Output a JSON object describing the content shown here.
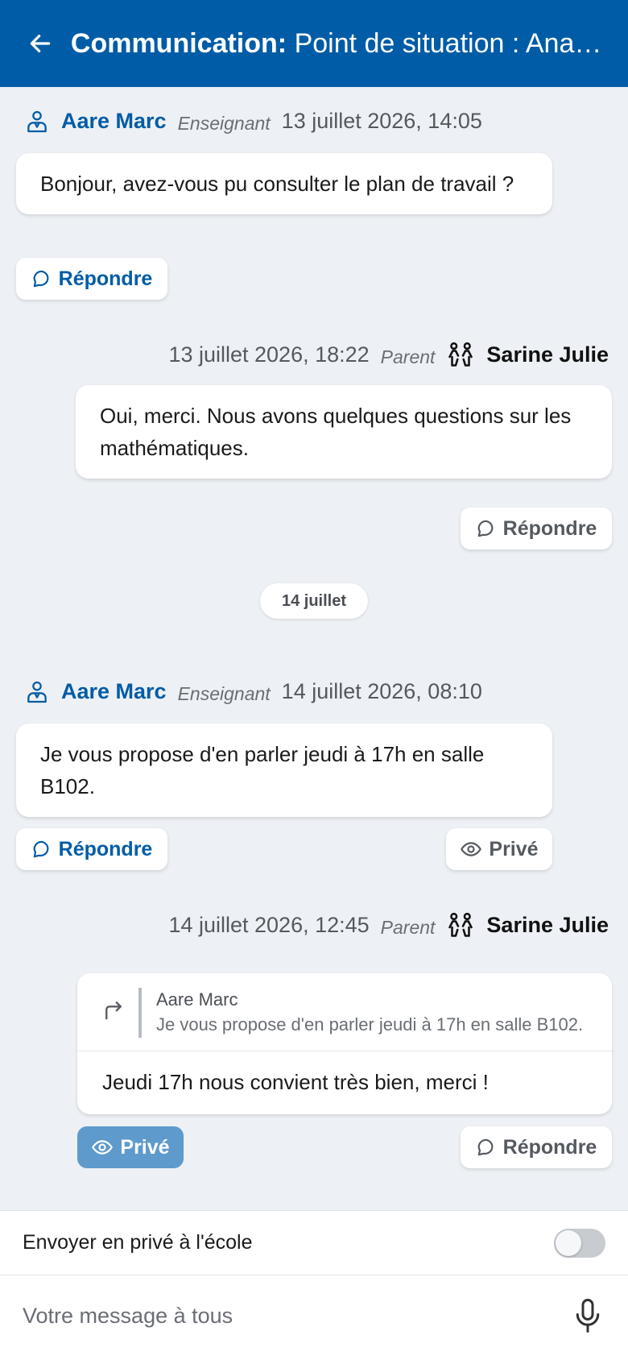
{
  "header": {
    "title_bold": "Communication:",
    "title_rest": "Point de situation : Anaïs ...",
    "back_icon": "arrow-left-icon"
  },
  "messages": [
    {
      "author": "Aare Marc",
      "role": "Enseignant",
      "date": "13 juillet 2026, 14:05",
      "text": "Bonjour, avez-vous pu consulter le plan de travail ?",
      "reply_label": "Répondre"
    },
    {
      "author": "Sarine Julie",
      "role": "Parent",
      "date": "13 juillet 2026, 18:22",
      "text": "Oui, merci. Nous avons quelques questions sur les mathématiques.",
      "reply_label": "Répondre"
    },
    {
      "author": "Aare Marc",
      "role": "Enseignant",
      "date": "14 juillet 2026, 08:10",
      "text": "Je vous propose d'en parler jeudi à 17h en salle B102.",
      "reply_label": "Répondre",
      "private_label": "Privé"
    },
    {
      "author": "Sarine Julie",
      "role": "Parent",
      "date": "14 juillet 2026, 12:45",
      "quote_author": "Aare Marc",
      "quote_text": "Je vous propose d'en parler jeudi à 17h en salle B102.",
      "text": "Jeudi 17h nous convient très bien, merci !",
      "private_label": "Privé",
      "reply_label": "Répondre"
    }
  ],
  "day_separator": "14 juillet",
  "composer": {
    "private_toggle_label": "Envoyer en privé à l'école",
    "private_toggle_on": false,
    "placeholder": "Votre message à tous",
    "mic_icon": "microphone-icon"
  },
  "colors": {
    "primary": "#005ca6",
    "background": "#edf0f4",
    "private_active": "#5e9acc"
  }
}
